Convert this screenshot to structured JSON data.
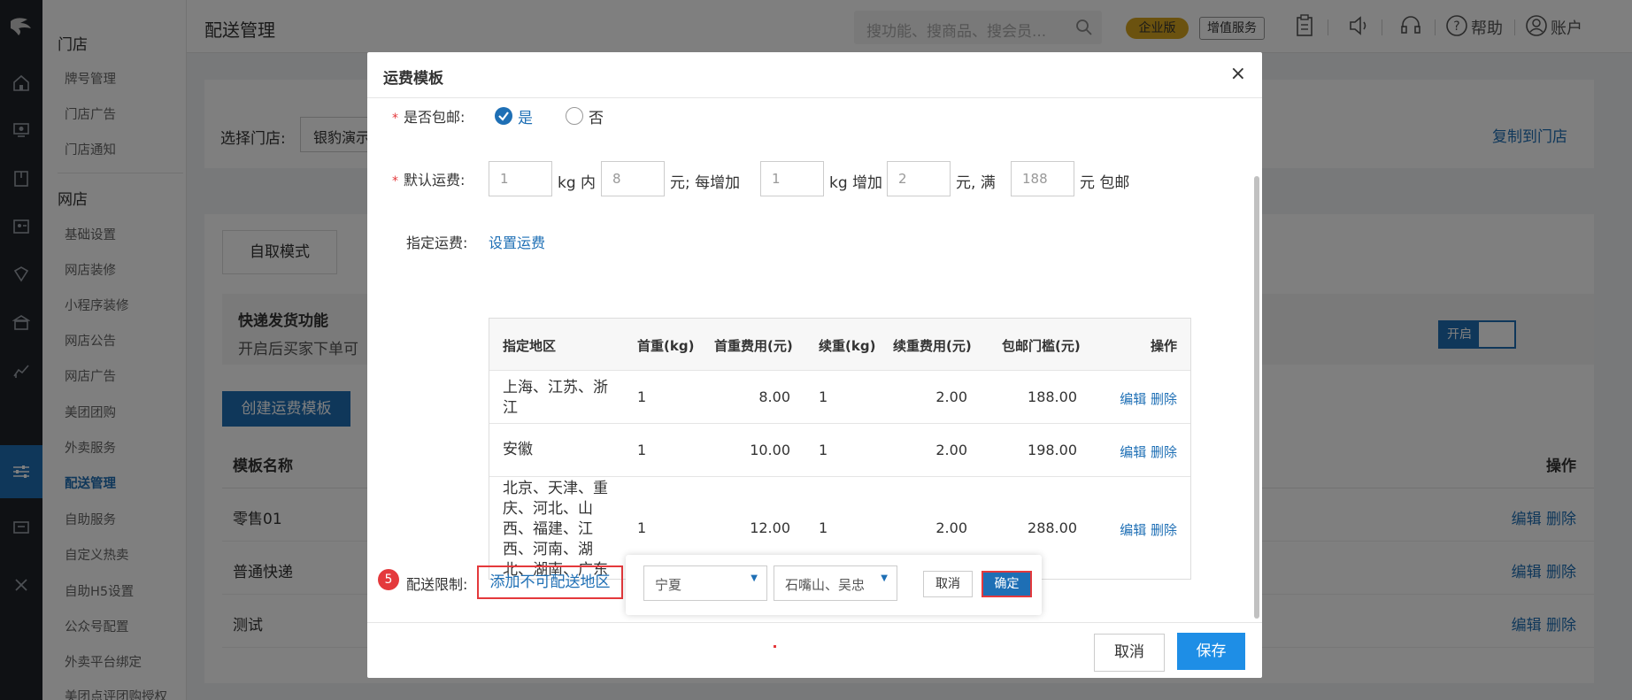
{
  "rail": {
    "icons": [
      "brand-logo-icon",
      "home-icon",
      "monitor-icon",
      "book-icon",
      "id-card-icon",
      "shield-icon",
      "bank-icon",
      "chart-icon",
      "sliders-icon",
      "message-icon",
      "tools-icon"
    ],
    "active": "sliders-icon"
  },
  "subnav": {
    "section1": "门店",
    "items1": [
      "牌号管理",
      "门店广告",
      "门店通知"
    ],
    "section2": "网店",
    "items2": [
      "基础设置",
      "网店装修",
      "小程序装修",
      "网店公告",
      "网店广告",
      "美团团购",
      "外卖服务",
      "配送管理",
      "自助服务",
      "自定义热卖",
      "自助H5设置",
      "公众号配置",
      "外卖平台绑定",
      "美团点评团购授权"
    ],
    "active_item": "配送管理"
  },
  "topbar": {
    "page_title": "配送管理",
    "search_placeholder": "搜功能、搜商品、搜会员...",
    "badge_enterprise": "企业版",
    "badge_addon": "增值服务",
    "help": "帮助",
    "account": "账户"
  },
  "main": {
    "store_label": "选择门店:",
    "store_value": "银豹演示",
    "copy_to_store": "复制到门店",
    "tab_pickup": "自取模式",
    "express_title": "快递发货功能",
    "express_desc": "开启后买家下单可",
    "toggle_label": "开启",
    "create_button": "创建运费模板",
    "col_name": "模板名称",
    "col_op": "操作",
    "rows": [
      "零售01",
      "普通快递",
      "测试"
    ],
    "edit": "编辑",
    "delete": "删除"
  },
  "modal": {
    "title": "运费模板",
    "close": "×",
    "free_shipping_label": "是否包邮:",
    "opt_yes": "是",
    "opt_no": "否",
    "default_fee_label": "默认运费:",
    "fee": {
      "first_weight": "1",
      "first_fee": "8",
      "step_weight": "1",
      "step_fee": "2",
      "free_threshold": "188",
      "u1": "kg 内",
      "u2": "元;  每增加",
      "u3": "kg 增加",
      "u4": "元, 满",
      "u5": "元 包邮"
    },
    "specified_label": "指定运费:",
    "set_fee_link": "设置运费",
    "table": {
      "headers": [
        "指定地区",
        "首重(kg)",
        "首重费用(元)",
        "续重(kg)",
        "续重费用(元)",
        "包邮门槛(元)",
        "操作"
      ],
      "rows": [
        {
          "region": "上海、江苏、浙江",
          "first_kg": "1",
          "first_fee": "8.00",
          "add_kg": "1",
          "add_fee": "2.00",
          "threshold": "188.00"
        },
        {
          "region": "安徽",
          "first_kg": "1",
          "first_fee": "10.00",
          "add_kg": "1",
          "add_fee": "2.00",
          "threshold": "198.00"
        },
        {
          "region": "北京、天津、重庆、河北、山西、福建、江西、河南、湖北、湖南、广东",
          "first_kg": "1",
          "first_fee": "12.00",
          "add_kg": "1",
          "add_fee": "2.00",
          "threshold": "288.00"
        }
      ],
      "op_edit": "编辑",
      "op_delete": "删除"
    },
    "step_number": "5",
    "restriction_label": "配送限制:",
    "add_restricted_link": "添加不可配送地区",
    "province_value": "宁夏",
    "city_value": "石嘴山、吴忠",
    "small_cancel": "取消",
    "small_confirm": "确定",
    "footer_cancel": "取消",
    "footer_save": "保存"
  },
  "colors": {
    "primary": "#1e6fb5",
    "save": "#1e8ee6",
    "danger": "#e4393c",
    "enterprise_badge": "#d6a51e"
  }
}
